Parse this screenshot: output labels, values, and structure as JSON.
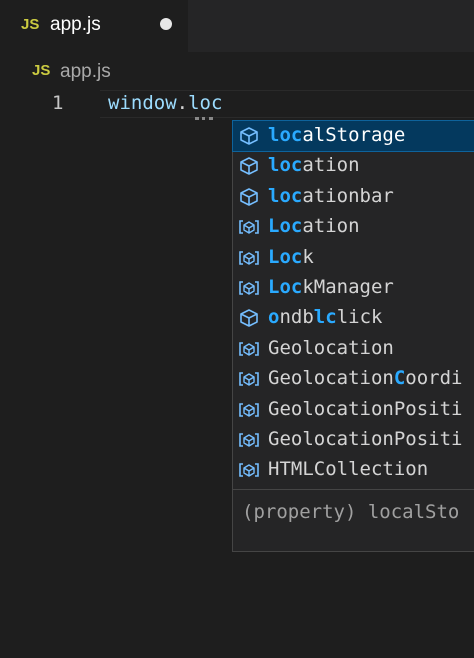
{
  "tab": {
    "badge": "JS",
    "title": "app.js"
  },
  "breadcrumb": {
    "badge": "JS",
    "file": "app.js"
  },
  "editor": {
    "line_number": "1",
    "code_before_dot": "window",
    "code_dot": ".",
    "code_after_dot": "loc"
  },
  "suggestions": [
    {
      "kind": "property-icon",
      "parts": [
        {
          "t": "loc",
          "h": true
        },
        {
          "t": "alStorage",
          "h": false
        }
      ],
      "selected": true
    },
    {
      "kind": "property-icon",
      "parts": [
        {
          "t": "loc",
          "h": true
        },
        {
          "t": "ation",
          "h": false
        }
      ]
    },
    {
      "kind": "property-icon",
      "parts": [
        {
          "t": "loc",
          "h": true
        },
        {
          "t": "ationbar",
          "h": false
        }
      ]
    },
    {
      "kind": "variable-icon",
      "parts": [
        {
          "t": "Loc",
          "h": true
        },
        {
          "t": "ation",
          "h": false
        }
      ]
    },
    {
      "kind": "variable-icon",
      "parts": [
        {
          "t": "Loc",
          "h": true
        },
        {
          "t": "k",
          "h": false
        }
      ]
    },
    {
      "kind": "variable-icon",
      "parts": [
        {
          "t": "Loc",
          "h": true
        },
        {
          "t": "kManager",
          "h": false
        }
      ]
    },
    {
      "kind": "property-icon",
      "parts": [
        {
          "t": "o",
          "h": true
        },
        {
          "t": "ndb",
          "h": false
        },
        {
          "t": "l",
          "h": true
        },
        {
          "t": "",
          "h": false
        },
        {
          "t": "c",
          "h": true
        },
        {
          "t": "lick",
          "h": false
        }
      ]
    },
    {
      "kind": "variable-icon",
      "parts": [
        {
          "t": "Geolocation",
          "h": false
        }
      ]
    },
    {
      "kind": "variable-icon",
      "parts": [
        {
          "t": "Geolocation",
          "h": false
        },
        {
          "t": "C",
          "h": true
        },
        {
          "t": "oordi",
          "h": false
        }
      ]
    },
    {
      "kind": "variable-icon",
      "parts": [
        {
          "t": "GeolocationPositi",
          "h": false
        }
      ]
    },
    {
      "kind": "variable-icon",
      "parts": [
        {
          "t": "GeolocationPositi",
          "h": false
        }
      ]
    },
    {
      "kind": "variable-icon",
      "parts": [
        {
          "t": "HTMLCollection",
          "h": false
        }
      ]
    }
  ],
  "details": "(property) localSto",
  "colors": {
    "accent": "#2aaaff",
    "selection": "#04395e",
    "js_badge": "#cbcb41"
  }
}
